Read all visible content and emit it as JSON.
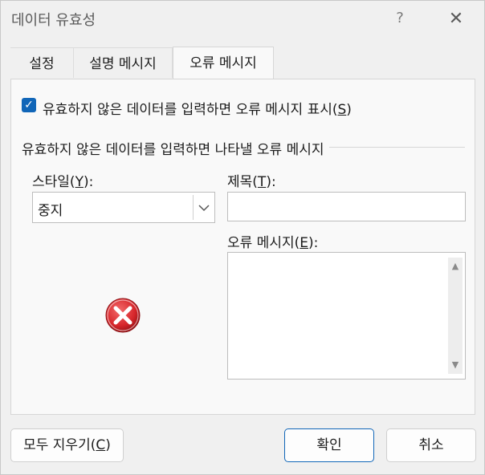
{
  "window": {
    "title": "데이터 유효성",
    "help_glyph": "?",
    "close_glyph": "✕"
  },
  "tabs": [
    {
      "label": "설정",
      "active": false
    },
    {
      "label": "설명 메시지",
      "active": false
    },
    {
      "label": "오류 메시지",
      "active": true
    }
  ],
  "show_error": {
    "checked": true,
    "label_text": "유효하지 않은 데이터를 입력하면 오류 메시지 표시(",
    "label_key": "S",
    "label_close": ")"
  },
  "group_title": "유효하지 않은 데이터를 입력하면 나타낼 오류 메시지",
  "style": {
    "label_text": "스타일(",
    "label_key": "Y",
    "label_close": "):",
    "value": "중지"
  },
  "title_field": {
    "label_text": "제목(",
    "label_key": "T",
    "label_close": "):",
    "value": ""
  },
  "message_field": {
    "label_text": "오류 메시지(",
    "label_key": "E",
    "label_close": "):",
    "value": ""
  },
  "icon": {
    "name": "error-stop-icon",
    "color": "#d7262b"
  },
  "buttons": {
    "clear_text": "모두 지우기(",
    "clear_key": "C",
    "clear_close": ")",
    "ok": "확인",
    "cancel": "취소"
  },
  "colors": {
    "accent": "#1166b8",
    "error": "#d7262b"
  }
}
